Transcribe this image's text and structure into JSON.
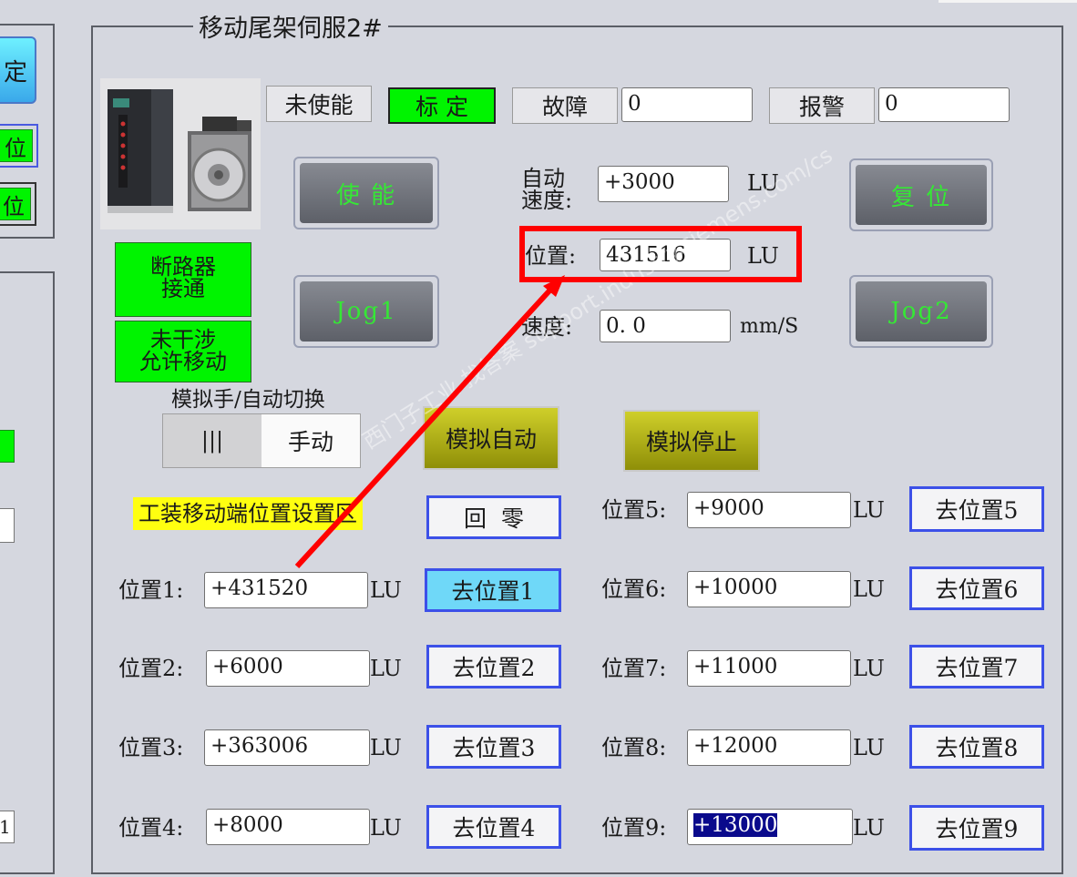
{
  "title": "移动尾架伺服2#",
  "left_panel": {
    "calib_fragment": "定",
    "pos1_fragment": "位",
    "pos2_fragment": "位",
    "lower_fragment": "1"
  },
  "status": {
    "disabled": "未使能",
    "calibrated": "标 定",
    "fault_label": "故障",
    "fault_value": "0",
    "alarm_label": "报警",
    "alarm_value": "0"
  },
  "buttons": {
    "enable": "使 能",
    "reset": "复 位",
    "jog1": "Jog1",
    "jog2": "Jog2"
  },
  "readouts": {
    "auto_speed_label_1": "自动",
    "auto_speed_label_2": "速度:",
    "auto_speed_value": "+3000",
    "auto_speed_unit": "LU",
    "position_label": "位置:",
    "position_value": "431516",
    "position_unit": "LU",
    "speed_label": "速度:",
    "speed_value": "0. 0",
    "speed_unit": "mm/S"
  },
  "indicators": {
    "breaker_1": "断路器",
    "breaker_2": "接通",
    "no_interfere_1": "未干涉",
    "no_interfere_2": "允许移动"
  },
  "mode": {
    "title": "模拟手/自动切换",
    "switch_left": "|||",
    "switch_right": "手动"
  },
  "sim": {
    "auto": "模拟自动",
    "stop": "模拟停止"
  },
  "setup": {
    "area_label": "工装移动端位置设置区",
    "home": "回  零"
  },
  "unit": "LU",
  "positions": [
    {
      "label": "位置1:",
      "value": "+431520",
      "button": "去位置1"
    },
    {
      "label": "位置2:",
      "value": "+6000",
      "button": "去位置2"
    },
    {
      "label": "位置3:",
      "value": "+363006",
      "button": "去位置3"
    },
    {
      "label": "位置4:",
      "value": "+8000",
      "button": "去位置4"
    },
    {
      "label": "位置5:",
      "value": "+9000",
      "button": "去位置5"
    },
    {
      "label": "位置6:",
      "value": "+10000",
      "button": "去位置6"
    },
    {
      "label": "位置7:",
      "value": "+11000",
      "button": "去位置7"
    },
    {
      "label": "位置8:",
      "value": "+12000",
      "button": "去位置8"
    },
    {
      "label": "位置9:",
      "value": "+13000",
      "button": "去位置9"
    }
  ],
  "watermark": "西门子工业 找答案 support.industry.siemens.com/cs",
  "colors": {
    "indicator_green": "#00f400",
    "highlight_red": "#ff0000",
    "button_border_blue": "#3c50e8",
    "area_label_yellow": "#ffff10"
  }
}
